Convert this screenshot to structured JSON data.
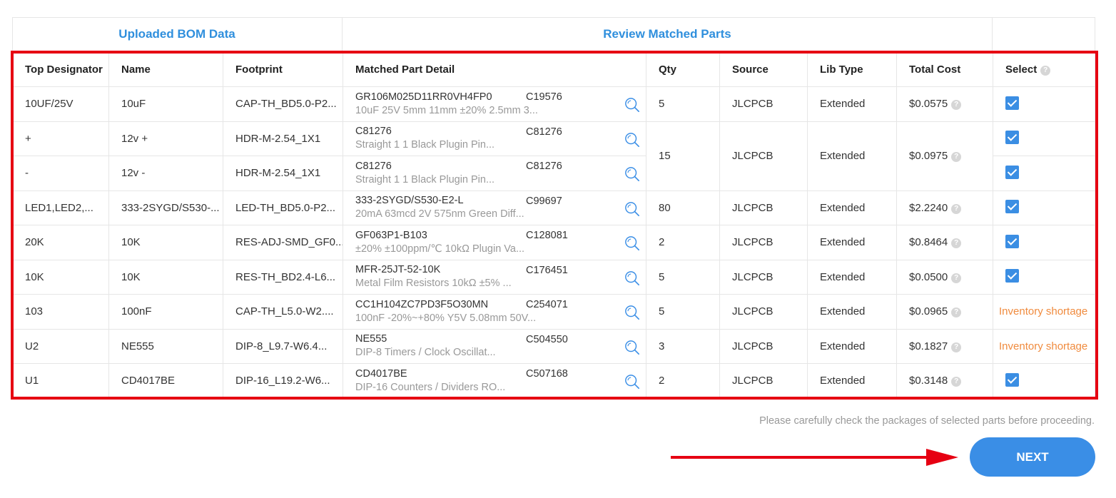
{
  "sections": {
    "uploaded": "Uploaded BOM Data",
    "review": "Review Matched Parts"
  },
  "columns": {
    "top_designator": "Top Designator",
    "name": "Name",
    "footprint": "Footprint",
    "matched": "Matched Part Detail",
    "qty": "Qty",
    "source": "Source",
    "lib_type": "Lib Type",
    "total_cost": "Total Cost",
    "select": "Select"
  },
  "rows": [
    {
      "designator": "10UF/25V",
      "name": "10uF",
      "footprint": "CAP-TH_BD5.0-P2...",
      "mpn": "GR106M025D11RR0VH4FP0",
      "lcsc": "C19576",
      "desc": "10uF 25V 5mm 11mm ±20% 2.5mm 3...",
      "qty": "5",
      "source": "JLCPCB",
      "lib": "Extended",
      "cost": "$0.0575",
      "select": "checked"
    },
    {
      "designator": "+",
      "name": "12v +",
      "footprint": "HDR-M-2.54_1X1",
      "mpn": "C81276",
      "lcsc": "C81276",
      "desc": "Straight 1 1 Black Plugin Pin...",
      "qty": "15",
      "source": "JLCPCB",
      "lib": "Extended",
      "cost": "$0.0975",
      "select": "checked"
    },
    {
      "designator": "-",
      "name": "12v -",
      "footprint": "HDR-M-2.54_1X1",
      "mpn": "C81276",
      "lcsc": "C81276",
      "desc": "Straight 1 1 Black Plugin Pin...",
      "select": "checked"
    },
    {
      "designator": "LED1,LED2,...",
      "name": "333-2SYGD/S530-...",
      "footprint": "LED-TH_BD5.0-P2...",
      "mpn": "333-2SYGD/S530-E2-L",
      "lcsc": "C99697",
      "desc": "20mA 63mcd 2V 575nm Green Diff...",
      "qty": "80",
      "source": "JLCPCB",
      "lib": "Extended",
      "cost": "$2.2240",
      "select": "checked"
    },
    {
      "designator": "20K",
      "name": "10K",
      "footprint": "RES-ADJ-SMD_GF0...",
      "mpn": "GF063P1-B103",
      "lcsc": "C128081",
      "desc": "±20% ±100ppm/℃ 10kΩ Plugin Va...",
      "qty": "2",
      "source": "JLCPCB",
      "lib": "Extended",
      "cost": "$0.8464",
      "select": "checked"
    },
    {
      "designator": "10K",
      "name": "10K",
      "footprint": "RES-TH_BD2.4-L6...",
      "mpn": "MFR-25JT-52-10K",
      "lcsc": "C176451",
      "desc": "Metal Film Resistors 10kΩ ±5% ...",
      "qty": "5",
      "source": "JLCPCB",
      "lib": "Extended",
      "cost": "$0.0500",
      "select": "checked"
    },
    {
      "designator": "103",
      "name": "100nF",
      "footprint": "CAP-TH_L5.0-W2....",
      "mpn": "CC1H104ZC7PD3F5O30MN",
      "lcsc": "C254071",
      "desc": "100nF -20%~+80% Y5V 5.08mm 50V...",
      "qty": "5",
      "source": "JLCPCB",
      "lib": "Extended",
      "cost": "$0.0965",
      "select": "Inventory shortage"
    },
    {
      "designator": "U2",
      "name": "NE555",
      "footprint": "DIP-8_L9.7-W6.4...",
      "mpn": "NE555",
      "lcsc": "C504550",
      "desc": "DIP-8 Timers / Clock Oscillat...",
      "qty": "3",
      "source": "JLCPCB",
      "lib": "Extended",
      "cost": "$0.1827",
      "select": "Inventory shortage"
    },
    {
      "designator": "U1",
      "name": "CD4017BE",
      "footprint": "DIP-16_L19.2-W6...",
      "mpn": "CD4017BE",
      "lcsc": "C507168",
      "desc": "DIP-16 Counters / Dividers RO...",
      "qty": "2",
      "source": "JLCPCB",
      "lib": "Extended",
      "cost": "$0.3148",
      "select": "checked"
    }
  ],
  "footer": {
    "note": "Please carefully check the packages of selected parts before proceeding.",
    "next": "NEXT"
  },
  "icons": {
    "search": "magnifier-icon",
    "help": "question-circle-icon",
    "checkbox": "checkbox-checked-icon"
  },
  "colors": {
    "accent": "#3a8ee6",
    "shortage": "#f08b3e",
    "highlight": "#e60012"
  }
}
